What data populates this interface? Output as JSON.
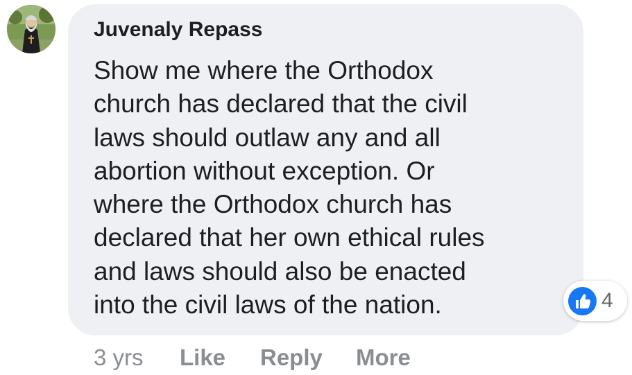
{
  "comment": {
    "author": "Juvenaly Repass",
    "text": "Show me where the Orthodox\nchurch has declared that the civil\nlaws should outlaw any and all\nabortion without exception. Or\nwhere the Orthodox church has\ndeclared that her own ethical rules\nand laws should also be enacted\ninto the civil laws of the nation.",
    "avatar_icon": "profile-photo",
    "bubble_color": "#eff0f3"
  },
  "reactions": {
    "icon": "thumbs-up-icon",
    "count": "4",
    "color": "#1877f2"
  },
  "actions": {
    "time": "3 yrs",
    "like": "Like",
    "reply": "Reply",
    "more": "More"
  }
}
